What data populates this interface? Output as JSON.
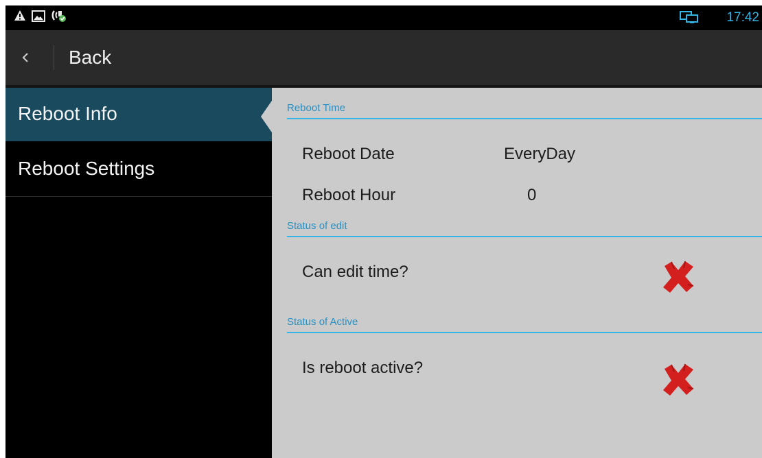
{
  "status_bar": {
    "icons": [
      "warning-icon",
      "gallery-icon",
      "phone-status-icon",
      "screen-cast-icon"
    ],
    "time": "17:42"
  },
  "action_bar": {
    "back_label": "Back"
  },
  "sidebar": {
    "items": [
      {
        "label": "Reboot Info",
        "selected": true
      },
      {
        "label": "Reboot Settings",
        "selected": false
      }
    ]
  },
  "content": {
    "reboot_time": {
      "header": "Reboot Time",
      "rows": [
        {
          "label": "Reboot Date",
          "value": "EveryDay"
        },
        {
          "label": "Reboot Hour",
          "value": "0"
        }
      ]
    },
    "status_edit": {
      "header": "Status of edit",
      "label": "Can edit time?",
      "status_icon": "red-x-icon"
    },
    "status_active": {
      "header": "Status of Active",
      "label": "Is reboot active?",
      "status_icon": "red-x-icon"
    }
  },
  "colors": {
    "accent": "#33b5e5",
    "header_text": "#2a8fc0",
    "selected_item": "#1a4a5e",
    "content_bg": "#cbcbcb",
    "status_negative": "#d41f1f"
  }
}
